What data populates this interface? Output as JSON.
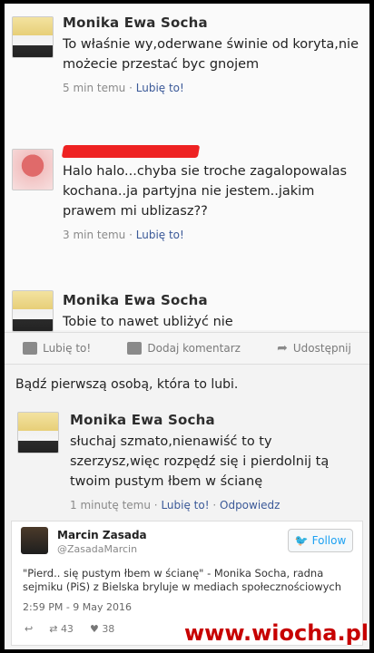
{
  "comments": [
    {
      "author": "Monika Ewa Socha",
      "text": "To właśnie wy,oderwane świnie od koryta,nie możecie przestać byc gnojem",
      "time": "5 min temu",
      "like": "Lubię to!"
    },
    {
      "author": "",
      "text": "Halo halo...chyba sie troche zagalopowalas kochana..ja partyjna nie jestem..jakim prawem mi ublizasz??",
      "time": "3 min temu",
      "like": "Lubię to!"
    },
    {
      "author": "Monika Ewa Socha",
      "text": "Tobie to nawet ubliżyć nie"
    }
  ],
  "actions": {
    "like": "Lubię to!",
    "comment": "Dodaj komentarz",
    "share": "Udostępnij"
  },
  "first_like": "Bądź pierwszą osobą, która to lubi.",
  "reply": {
    "author": "Monika Ewa Socha",
    "text": "słuchaj szmato,nienawiść to ty szerzysz,więc rozpędź się i pierdolnij tą twoim pustym łbem w ścianę",
    "time": "1 minutę temu",
    "like": "Lubię to!",
    "respond": "Odpowiedz"
  },
  "tweet": {
    "name": "Marcin Zasada",
    "handle": "@ZasadaMarcin",
    "follow": "Follow",
    "text": "\"Pierd.. się pustym łbem w ścianę\" - Monika Socha, radna sejmiku (PiS) z Bielska bryluje w mediach społecznościowych",
    "time": "2:59 PM - 9 May 2016",
    "retweets": "43",
    "likes": "38"
  },
  "watermark": "www.wiocha.pl",
  "colors": {
    "link": "#3b5998",
    "twitter": "#1da1f2",
    "watermark": "#c70000"
  }
}
